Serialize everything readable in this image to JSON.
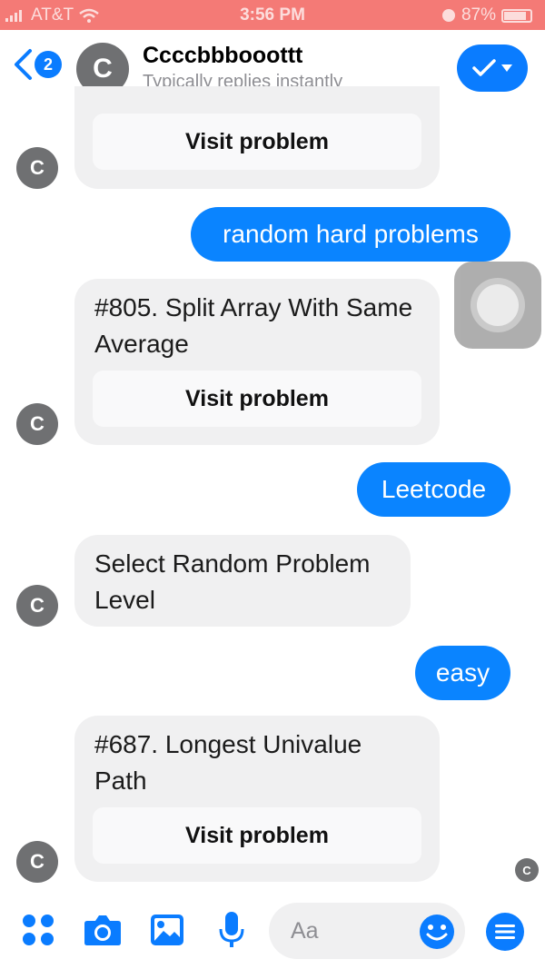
{
  "status_bar": {
    "carrier": "AT&T",
    "time": "3:56 PM",
    "battery": "87%"
  },
  "header": {
    "back_badge": "2",
    "avatar_letter": "C",
    "contact_name": "Ccccbbbooottt",
    "contact_status": "Typically replies instantly"
  },
  "messages": [
    {
      "type": "card",
      "button": "Visit problem"
    },
    {
      "type": "outgoing",
      "text": "random hard problems"
    },
    {
      "type": "card",
      "text": "#805. Split Array With Same Average",
      "button": "Visit problem"
    },
    {
      "type": "outgoing",
      "text": "Leetcode"
    },
    {
      "type": "incoming",
      "text": "Select Random Problem Level"
    },
    {
      "type": "outgoing",
      "text": "easy"
    },
    {
      "type": "card",
      "text": "#687. Longest Univalue Path",
      "button": "Visit problem"
    }
  ],
  "bot_avatar_letter": "C",
  "composer": {
    "placeholder": "Aa"
  },
  "colors": {
    "accent": "#0a7cff",
    "status_bar": "#f47a76",
    "bubble_incoming": "#f0f0f1"
  }
}
